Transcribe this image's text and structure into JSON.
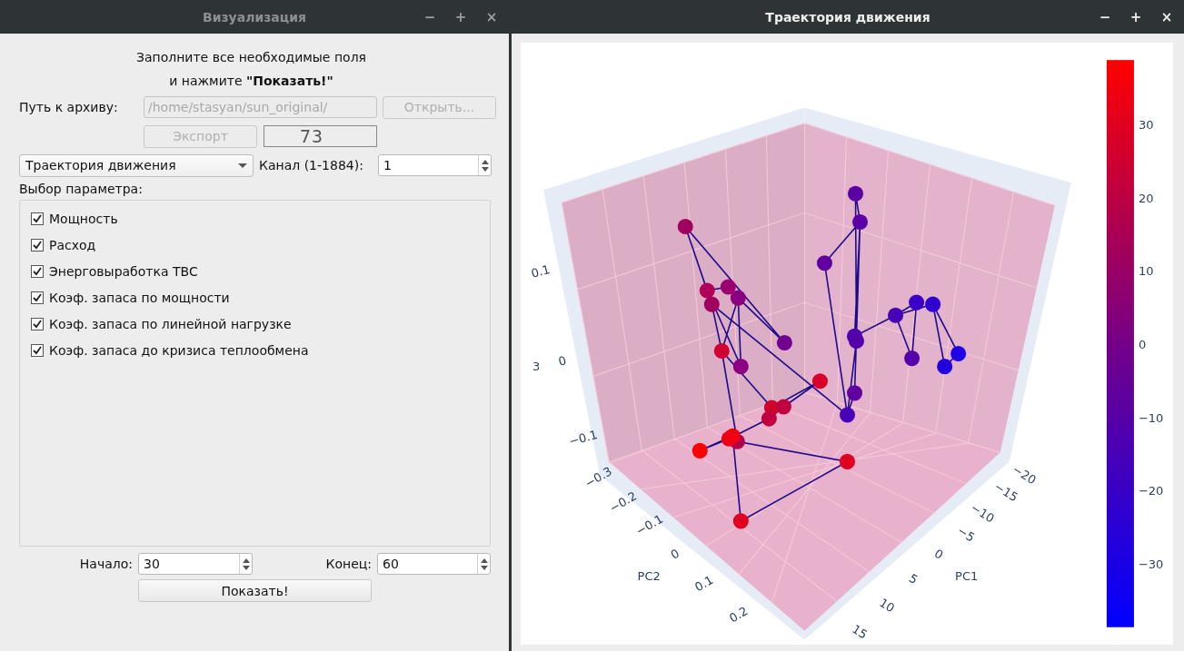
{
  "settings_window": {
    "title": "Визуализация",
    "active": false,
    "window_buttons": [
      "−",
      "+",
      "×"
    ],
    "instructions": [
      "Заполните все необходимые поля",
      "и нажмите **\"Показать!\"**"
    ],
    "path_label": "Путь к архиву:",
    "path_field": {
      "value": "/home/stasyan/sun_original/",
      "disabled": true
    },
    "open_button": {
      "label": "Открыть...",
      "disabled": true
    },
    "export_button": {
      "label": "Экспорт",
      "disabled": true
    },
    "counter": "73",
    "mode_select": "Траектория движения",
    "channel_label": "Канал (1-1884):",
    "channel_value": "1",
    "params_label": "Выбор параметра:",
    "params": [
      {
        "label": "Мощность",
        "checked": true
      },
      {
        "label": "Расход",
        "checked": true
      },
      {
        "label": "Энерговыработка ТВС",
        "checked": true
      },
      {
        "label": "Коэф. запаса по мощности",
        "checked": true
      },
      {
        "label": "Коэф. запаса по линейной нагрузке",
        "checked": true
      },
      {
        "label": "Коэф. запаса до кризиса теплообмена",
        "checked": true
      }
    ],
    "start_label": "Начало:",
    "start_value": "30",
    "end_label": "Конец:",
    "end_value": "60",
    "show_button": "Показать!"
  },
  "plot_window": {
    "title": "Траектория движения",
    "active": true,
    "window_buttons": [
      "−",
      "+",
      "×"
    ],
    "z_axis": {
      "title": "3",
      "ticks": [
        "0.1",
        "0",
        "−0.1"
      ]
    },
    "pc2_axis": {
      "title": "PC2",
      "ticks": [
        "−0.3",
        "−0.2",
        "−0.1",
        "0",
        "0.1",
        "0.2"
      ]
    },
    "pc1_axis": {
      "title": "PC1",
      "ticks": [
        "−20",
        "−15",
        "−10",
        "−5",
        "0",
        "5",
        "10",
        "15"
      ]
    },
    "colorbar_ticks": [
      "30",
      "20",
      "10",
      "0",
      "−10",
      "−20",
      "−30"
    ]
  }
}
